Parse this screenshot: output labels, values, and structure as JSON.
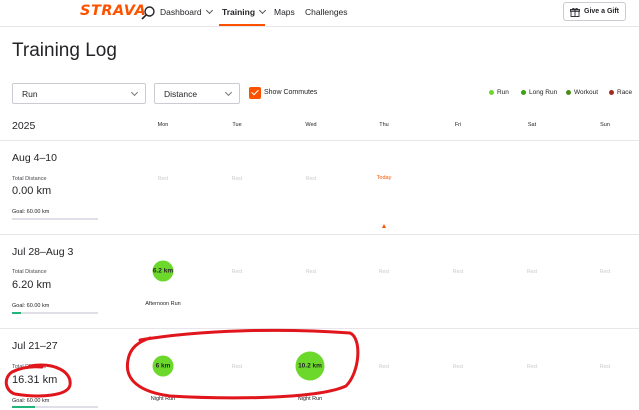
{
  "nav": {
    "logo": "STRAVA",
    "items": [
      {
        "label": "Dashboard"
      },
      {
        "label": "Training"
      },
      {
        "label": "Maps"
      },
      {
        "label": "Challenges"
      }
    ],
    "gift_label": "Give a Gift"
  },
  "page_title": "Training Log",
  "filters": {
    "activity_type": "Run",
    "metric": "Distance",
    "commutes_label": "Show Commutes",
    "commutes_checked": true
  },
  "legend": [
    {
      "label": "Run",
      "color": "#6cd82b"
    },
    {
      "label": "Long Run",
      "color": "#3aa30e"
    },
    {
      "label": "Workout",
      "color": "#4a8d1c"
    },
    {
      "label": "Race",
      "color": "#a52a1e"
    }
  ],
  "calendar": {
    "year": "2025",
    "days": [
      "Mon",
      "Tue",
      "Wed",
      "Thu",
      "Fri",
      "Sat",
      "Sun"
    ],
    "rest_label": "Rest",
    "today_label": "Today"
  },
  "weeks": [
    {
      "label": "Aug 4–10",
      "stat_label": "Total Distance",
      "value": "0.00 km",
      "goal": "Goal: 60.00 km",
      "goal_progress": 0.0
    },
    {
      "label": "Jul 28–Aug 3",
      "stat_label": "Total Distance",
      "value": "6.20 km",
      "goal": "Goal: 60.00 km",
      "goal_progress": 0.103,
      "activities": [
        {
          "bubble": "6.2 km",
          "name": "Afternoon Run"
        }
      ]
    },
    {
      "label": "Jul 21–27",
      "stat_label": "Total Distance",
      "value": "16.31 km",
      "goal": "Goal: 60.00 km",
      "goal_progress": 0.272,
      "activities": [
        {
          "bubble": "6 km",
          "name": "Night Run"
        },
        {
          "bubble": "10.2 km",
          "name": "Night Run"
        }
      ]
    }
  ],
  "annotation_color": "#e0161c"
}
